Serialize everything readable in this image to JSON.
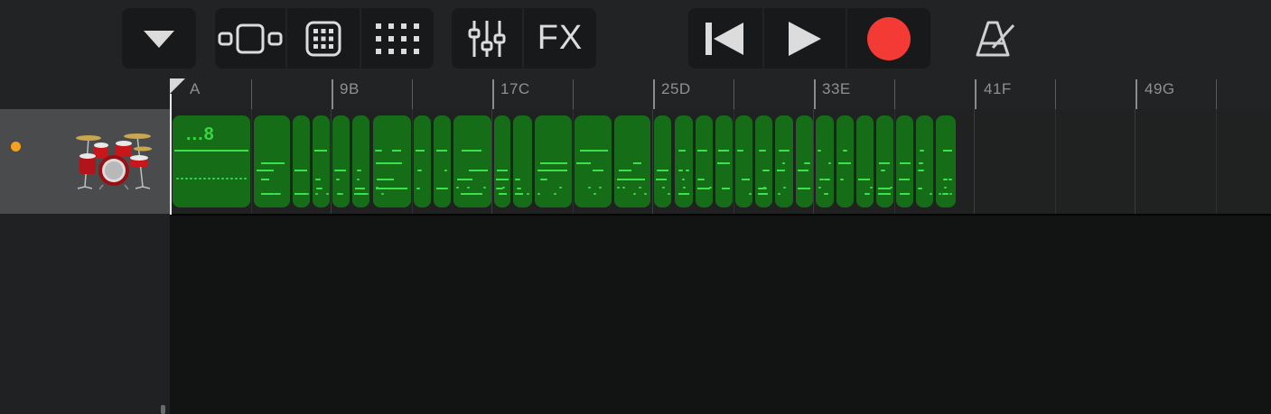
{
  "toolbar": {
    "groups": [
      {
        "items": [
          {
            "name": "tracks-menu-button",
            "icon": "triangle-down-icon"
          }
        ]
      },
      {
        "items": [
          {
            "name": "tracks-view-button",
            "icon": "tracks-view-icon"
          },
          {
            "name": "touch-instrument-button",
            "icon": "keypad-icon"
          },
          {
            "name": "grid-view-button",
            "icon": "dot-grid-icon"
          }
        ]
      },
      {
        "items": [
          {
            "name": "mixer-button",
            "icon": "sliders-icon"
          },
          {
            "name": "fx-button",
            "label": "FX"
          }
        ]
      },
      {
        "items": [
          {
            "name": "go-to-start-button",
            "icon": "skip-back-icon"
          },
          {
            "name": "play-button",
            "icon": "play-icon"
          },
          {
            "name": "record-button",
            "icon": "record-icon",
            "color": "#f43a34"
          }
        ]
      },
      {
        "items": [
          {
            "name": "metronome-button",
            "icon": "metronome-icon"
          }
        ]
      }
    ],
    "fx_label": "FX"
  },
  "ruler": {
    "labels": [
      "A",
      "9B",
      "17C",
      "25D",
      "33E",
      "41F",
      "49G"
    ]
  },
  "track": {
    "name": "Drums",
    "icon": "drum-kit-icon",
    "indicator_color": "#f6a021",
    "region_label": "...8",
    "region_color": "#166d18",
    "note_color": "#3be34a"
  }
}
